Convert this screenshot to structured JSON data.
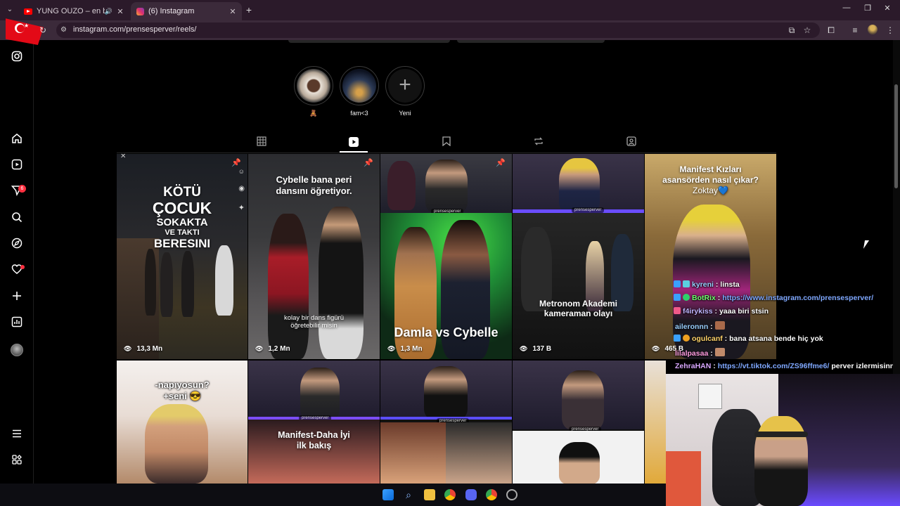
{
  "browser": {
    "tabs": [
      {
        "title": "YUNG OUZO – en baba rüz",
        "active": false
      },
      {
        "title": "(6) Instagram",
        "active": true
      }
    ],
    "url": "instagram.com/prensesperver/reels/"
  },
  "nav": {
    "notification_count": "6"
  },
  "highlights": [
    {
      "label": "🧸"
    },
    {
      "label": "fam<3"
    },
    {
      "label": "Yeni"
    }
  ],
  "reels": [
    {
      "overlay_lines": [
        "KÖTÜ",
        "ÇOCUK",
        "SOKAKTA",
        "VE TAKTI",
        "BERESINI"
      ],
      "views": "13,3 Mn"
    },
    {
      "overlay_lines": [
        "Cybelle bana peri",
        "dansını öğretiyor."
      ],
      "subtitle_lines": [
        "kolay bir dans figürü",
        "öğretebilir misin"
      ],
      "views": "1,2 Mn"
    },
    {
      "overlay_lines": [
        "Damla vs Cybelle"
      ],
      "views": "1,3 Mn"
    },
    {
      "overlay_lines": [
        "Metronom Akademi",
        "kameraman olayı"
      ],
      "views": "137 B"
    },
    {
      "overlay_lines": [
        "Manifest Kızları",
        "asansörden nasıl çıkar?",
        "Zoktay💙"
      ],
      "views": "465 B"
    },
    {
      "overlay_lines": [
        "-napıyosun?",
        "+seni 😎"
      ]
    },
    {
      "overlay_lines": []
    },
    {
      "overlay_lines": [
        "Manifest-Daha İyi",
        "ilk bakış"
      ]
    },
    {
      "overlay_lines": []
    }
  ],
  "watermark": "prensesperver",
  "chat": [
    {
      "user": "kyreni",
      "msg": "linsta",
      "color": "u-blue"
    },
    {
      "user": "BotRix",
      "msg": "https://www.instagram.com/prensesperver/",
      "color": "u-green",
      "link": true
    },
    {
      "user": "f4irykiss",
      "msg": "yaaa biri stsin",
      "color": "u-lav"
    },
    {
      "user": "aileronnn",
      "msg": "",
      "color": "u-blue"
    },
    {
      "user": "ogulcanf",
      "msg": "bana atsana bende hiç yok",
      "color": "u-gold"
    },
    {
      "user": "lilalpasaa",
      "msg": "",
      "color": "u-pink"
    },
    {
      "user": "ZehraHAN",
      "msg": "https://vt.tiktok.com/ZS96ffme6/",
      "tail": "perver izlermisinnn",
      "color": "u-purple",
      "link": true
    }
  ],
  "colors": {
    "accent": "#ff3040",
    "browser_frame": "#3b2a3a",
    "background": "#000000"
  }
}
